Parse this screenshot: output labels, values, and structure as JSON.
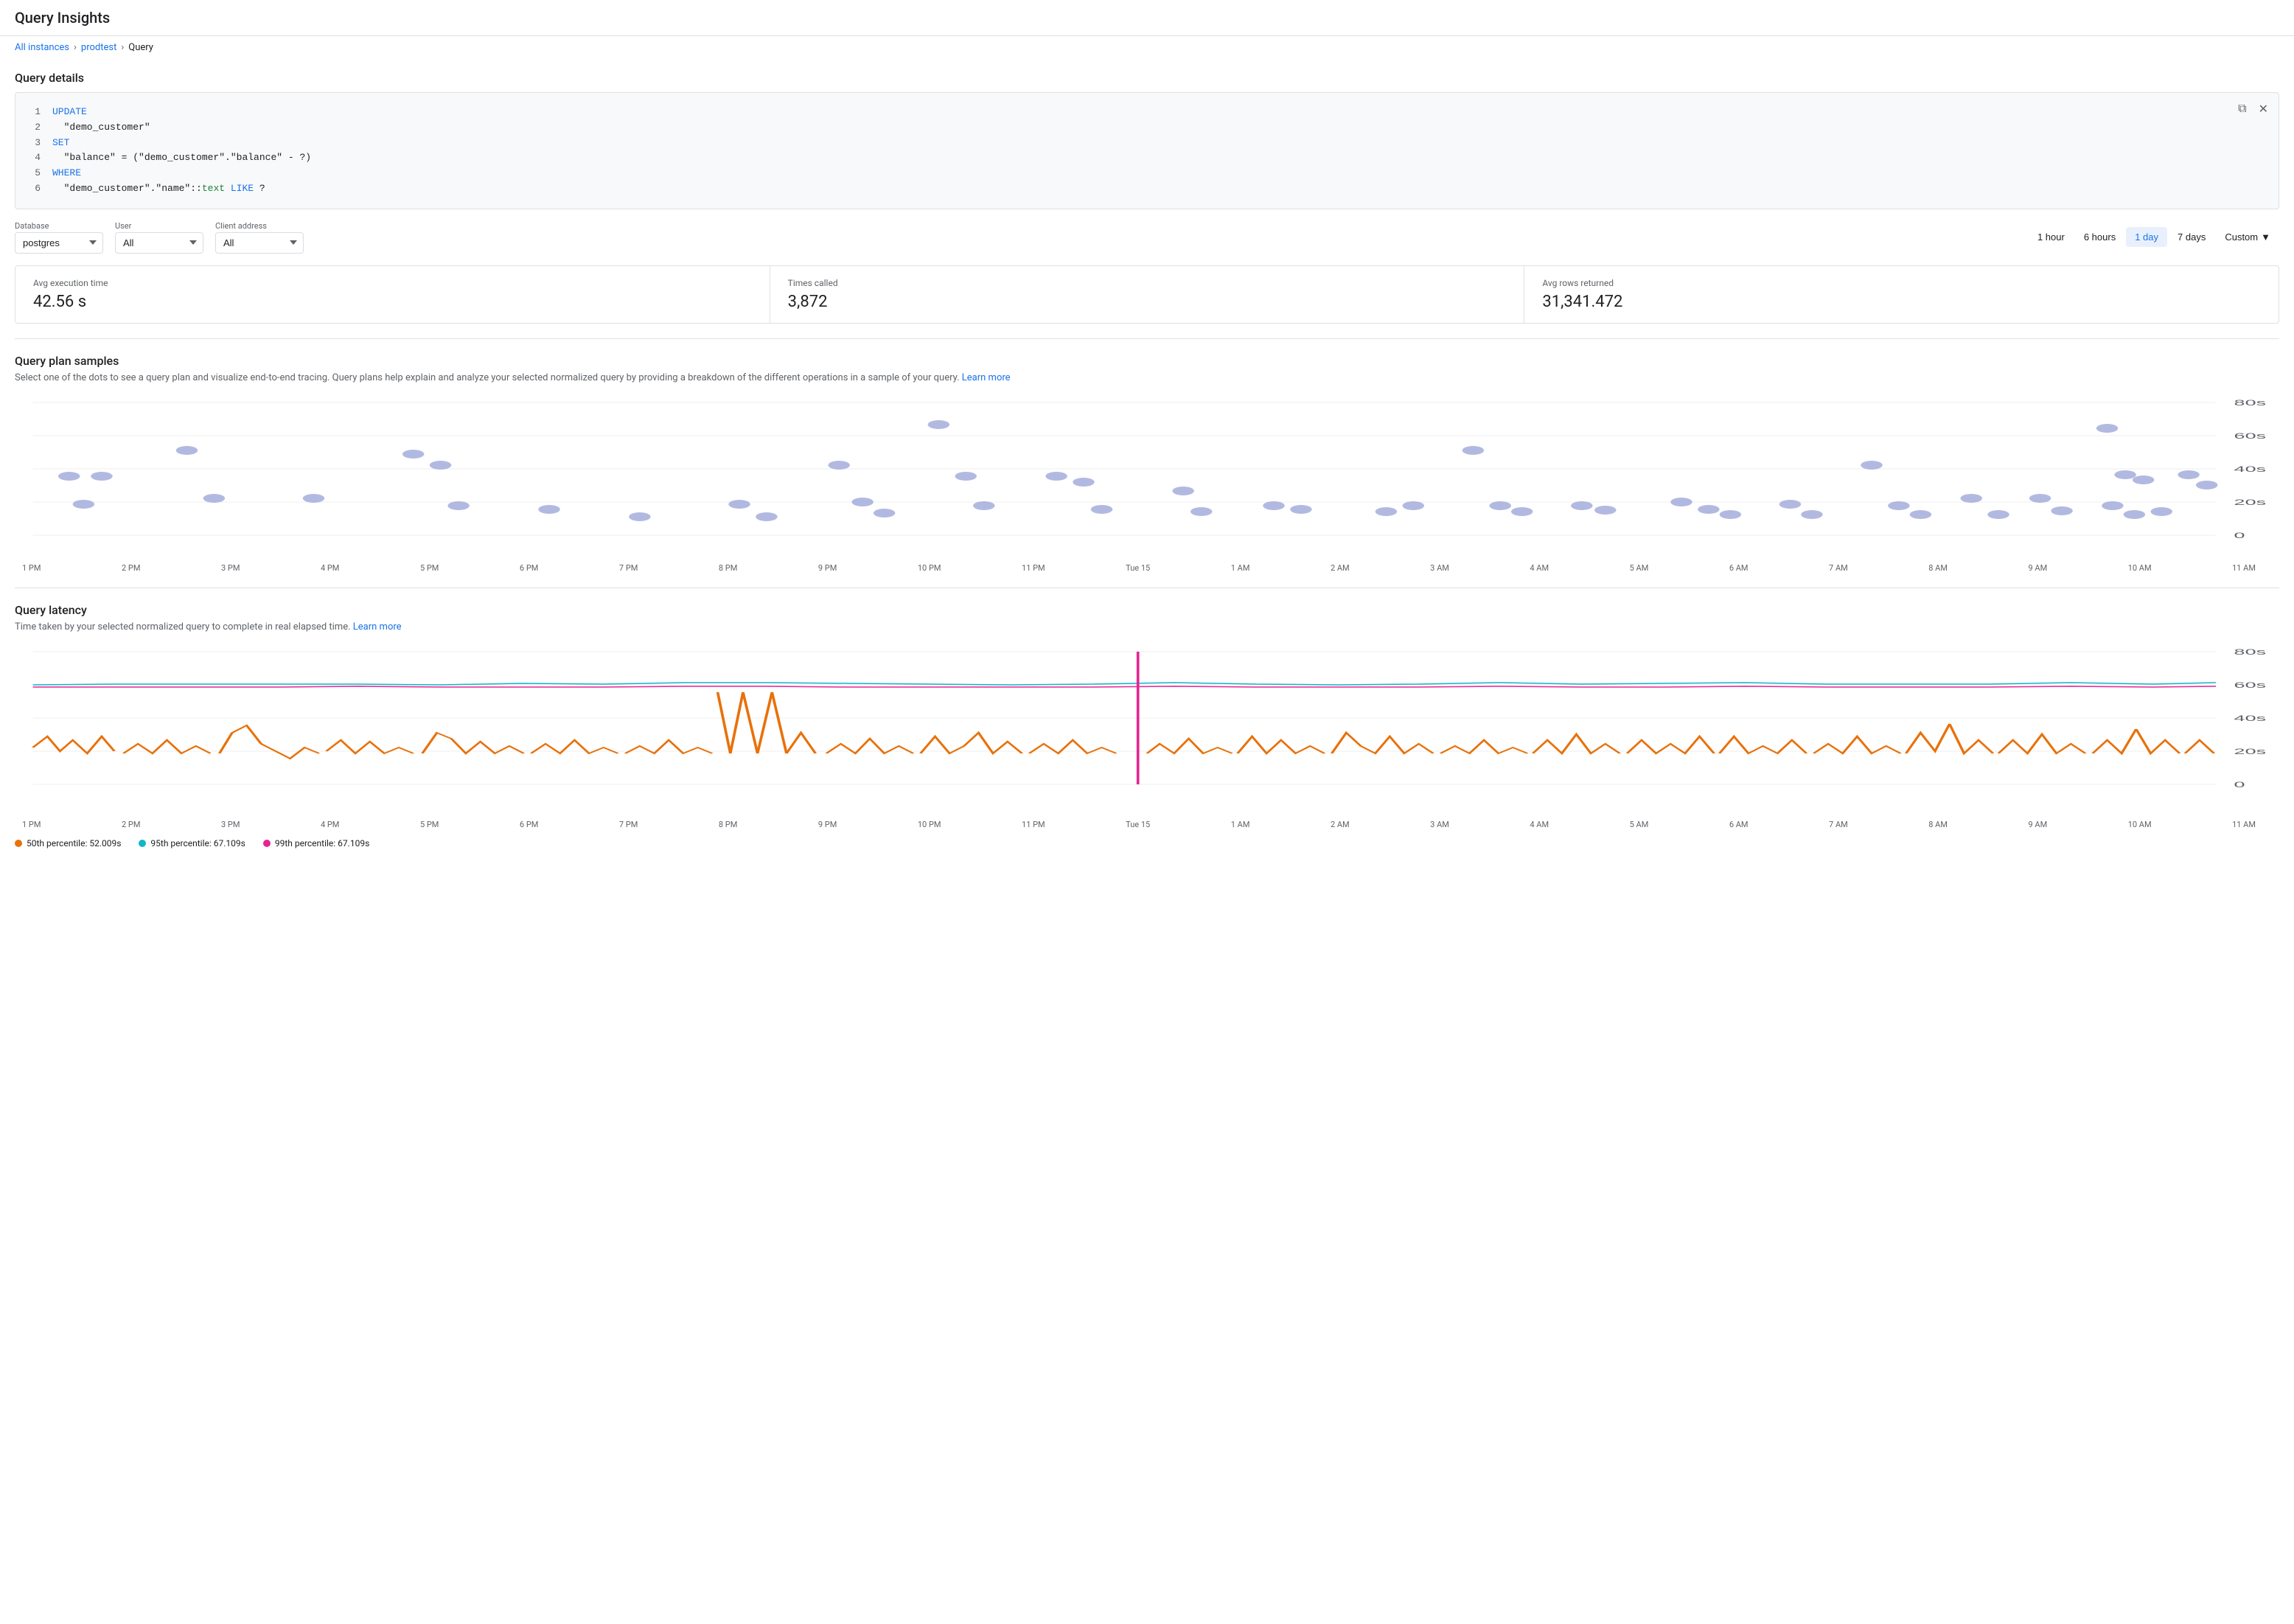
{
  "header": {
    "title": "Query Insights"
  },
  "breadcrumb": {
    "all_instances": "All instances",
    "prodtest": "prodtest",
    "current": "Query"
  },
  "query_details": {
    "section_title": "Query details",
    "code_lines": [
      {
        "num": 1,
        "parts": [
          {
            "type": "kw-blue",
            "text": "UPDATE"
          }
        ]
      },
      {
        "num": 2,
        "parts": [
          {
            "type": "plain",
            "text": "  \"demo_customer\""
          }
        ]
      },
      {
        "num": 3,
        "parts": [
          {
            "type": "kw-blue",
            "text": "SET"
          }
        ]
      },
      {
        "num": 4,
        "parts": [
          {
            "type": "plain",
            "text": "  \"balance\" = (\"demo_customer\".\"balance\" - ?)"
          }
        ]
      },
      {
        "num": 5,
        "parts": [
          {
            "type": "kw-blue",
            "text": "WHERE"
          }
        ]
      },
      {
        "num": 6,
        "parts": [
          {
            "type": "plain",
            "text": "  \"demo_customer\".\"name\"::"
          },
          {
            "type": "kw-text",
            "text": "text"
          },
          {
            "type": "plain",
            "text": " "
          },
          {
            "type": "kw-blue",
            "text": "LIKE"
          },
          {
            "type": "plain",
            "text": " ?"
          }
        ]
      }
    ]
  },
  "filters": {
    "database_label": "Database",
    "database_value": "postgres",
    "user_label": "User",
    "user_value": "All",
    "client_label": "Client address",
    "client_value": "All"
  },
  "time_range": {
    "options": [
      "1 hour",
      "6 hours",
      "1 day",
      "7 days"
    ],
    "active": "1 day",
    "custom_label": "Custom"
  },
  "stats": [
    {
      "label": "Avg execution time",
      "value": "42.56 s"
    },
    {
      "label": "Times called",
      "value": "3,872"
    },
    {
      "label": "Avg rows returned",
      "value": "31,341.472"
    }
  ],
  "query_plan": {
    "title": "Query plan samples",
    "description": "Select one of the dots to see a query plan and visualize end-to-end tracing. Query plans help explain and analyze your selected normalized query by providing a breakdown of the different operations in a sample of your query.",
    "learn_more": "Learn more",
    "x_labels": [
      "1 PM",
      "2 PM",
      "3 PM",
      "4 PM",
      "5 PM",
      "6 PM",
      "7 PM",
      "8 PM",
      "9 PM",
      "10 PM",
      "11 PM",
      "Tue 15",
      "1 AM",
      "2 AM",
      "3 AM",
      "4 AM",
      "5 AM",
      "6 AM",
      "7 AM",
      "8 AM",
      "9 AM",
      "10 AM",
      "11 AM"
    ],
    "y_labels": [
      "80s",
      "60s",
      "40s",
      "20s",
      "0"
    ]
  },
  "query_latency": {
    "title": "Query latency",
    "description": "Time taken by your selected normalized query to complete in real elapsed time.",
    "learn_more": "Learn more",
    "x_labels": [
      "1 PM",
      "2 PM",
      "3 PM",
      "4 PM",
      "5 PM",
      "6 PM",
      "7 PM",
      "8 PM",
      "9 PM",
      "10 PM",
      "11 PM",
      "Tue 15",
      "1 AM",
      "2 AM",
      "3 AM",
      "4 AM",
      "5 AM",
      "6 AM",
      "7 AM",
      "8 AM",
      "9 AM",
      "10 AM",
      "11 AM"
    ],
    "y_labels": [
      "80s",
      "60s",
      "40s",
      "20s",
      "0"
    ],
    "legend": [
      {
        "color": "#e8710a",
        "label": "50th percentile: 52.009s"
      },
      {
        "color": "#12b5cb",
        "label": "95th percentile: 67.109s"
      },
      {
        "color": "#e52592",
        "label": "99th percentile: 67.109s"
      }
    ]
  }
}
